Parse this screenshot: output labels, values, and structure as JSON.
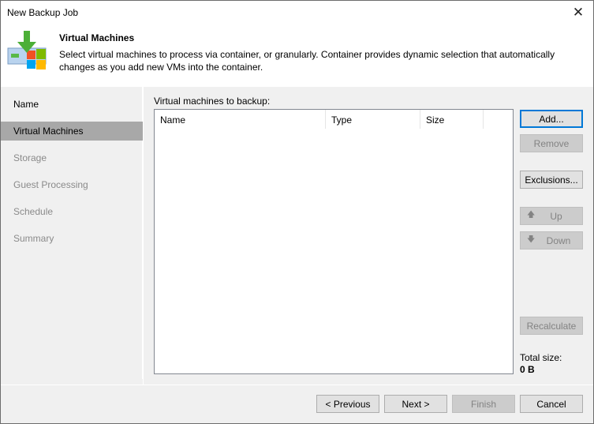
{
  "window": {
    "title": "New Backup Job",
    "close_icon": "close-icon"
  },
  "header": {
    "icon": "vm-backup-icon",
    "title": "Virtual Machines",
    "description": "Select virtual machines to process via container, or granularly. Container provides dynamic selection that automatically changes as you add new VMs into the container."
  },
  "sidebar": {
    "items": [
      {
        "label": "Name",
        "state": "done"
      },
      {
        "label": "Virtual Machines",
        "state": "active"
      },
      {
        "label": "Storage",
        "state": "pending"
      },
      {
        "label": "Guest Processing",
        "state": "pending"
      },
      {
        "label": "Schedule",
        "state": "pending"
      },
      {
        "label": "Summary",
        "state": "pending"
      }
    ]
  },
  "main": {
    "list_label": "Virtual machines to backup:",
    "columns": [
      "Name",
      "Type",
      "Size"
    ],
    "rows": []
  },
  "actions": {
    "add": "Add...",
    "remove": "Remove",
    "exclusions": "Exclusions...",
    "up": "Up",
    "down": "Down",
    "recalculate": "Recalculate",
    "up_icon": "arrow-up-icon",
    "down_icon": "arrow-down-icon"
  },
  "total": {
    "label": "Total size:",
    "value": "0 B"
  },
  "footer": {
    "previous": "< Previous",
    "next": "Next >",
    "finish": "Finish",
    "cancel": "Cancel"
  },
  "colors": {
    "accent": "#0078d7",
    "active_step_bg": "#a8a8a8",
    "arrow_green": "#4caf37"
  }
}
